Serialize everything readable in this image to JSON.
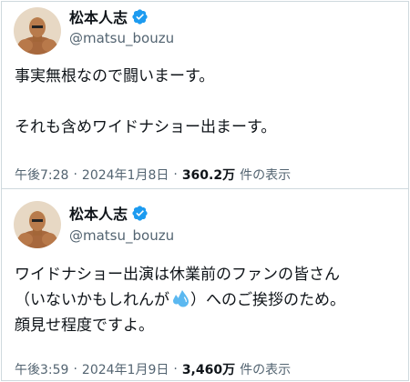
{
  "tweets": [
    {
      "display_name": "松本人志",
      "handle": "@matsu_bouzu",
      "lines": [
        "事実無根なので闘いまーす。",
        "",
        "それも含めワイドナショー出まーす。"
      ],
      "time": "午後7:28",
      "separator": "·",
      "date": "2024年1月8日",
      "views": "360.2万",
      "views_label": "件の表示"
    },
    {
      "display_name": "松本人志",
      "handle": "@matsu_bouzu",
      "line1": "ワイドナショー出演は休業前のファンの皆さん",
      "line2_a": "（いないかもしれんが",
      "line2_b": "）へのご挨拶のため。",
      "line3": "顔見せ程度ですよ。",
      "emoji_icon": "sweat-droplets-icon",
      "time": "午後3:59",
      "separator": "·",
      "date": "2024年1月9日",
      "views": "3,460万",
      "views_label": "件の表示"
    }
  ],
  "colors": {
    "verified": "#1d9bf0",
    "secondary_text": "#536471",
    "primary_text": "#0f1419",
    "border": "#cfd9de",
    "droplet": "#5bb8f0"
  }
}
